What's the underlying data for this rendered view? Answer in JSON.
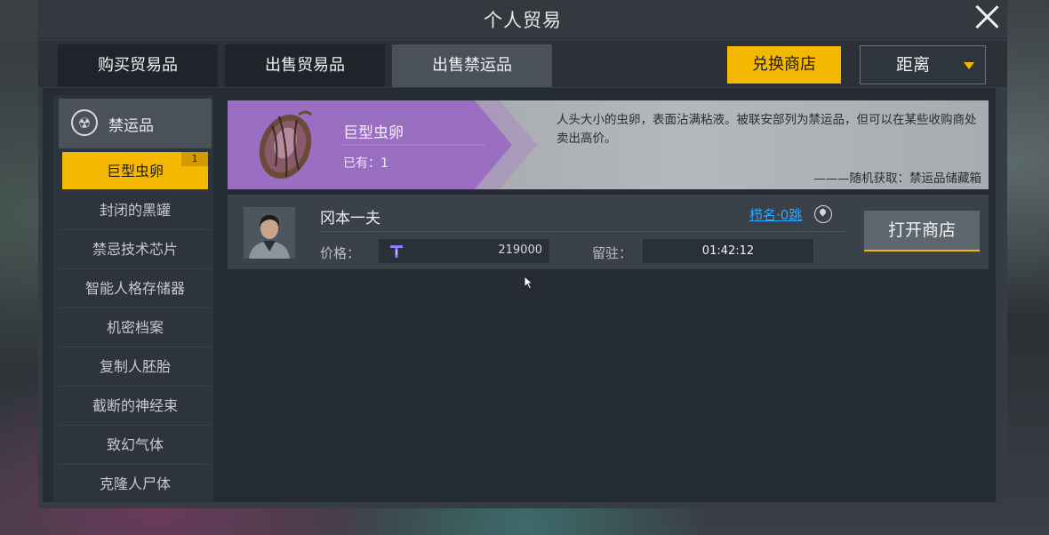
{
  "window": {
    "title": "个人贸易"
  },
  "tabs": [
    {
      "label": "购买贸易品"
    },
    {
      "label": "出售贸易品"
    },
    {
      "label": "出售禁运品",
      "active": true
    }
  ],
  "toolbar": {
    "exchange_label": "兑换商店",
    "distance_label": "距离"
  },
  "sidebar": {
    "category": {
      "label": "禁运品",
      "icon": "radiation-icon"
    },
    "items": [
      {
        "label": "巨型虫卵",
        "selected": true,
        "badge": "1"
      },
      {
        "label": "封闭的黑罐"
      },
      {
        "label": "禁忌技术芯片"
      },
      {
        "label": "智能人格存储器"
      },
      {
        "label": "机密档案"
      },
      {
        "label": "复制人胚胎"
      },
      {
        "label": "截断的神经束"
      },
      {
        "label": "致幻气体"
      },
      {
        "label": "克隆人尸体"
      }
    ]
  },
  "item": {
    "name": "巨型虫卵",
    "owned": "已有：1",
    "description": "人头大小的虫卵，表面沾满粘液。被联安部列为禁运品，但可以在某些收购商处卖出高价。",
    "source": "———随机获取：禁运品储藏箱"
  },
  "seller": {
    "name": "冈本一夫",
    "jump": "栉名·0跳",
    "price_label": "价格：",
    "price": "219000",
    "stay_label": "留驻：",
    "stay_time": "01:42:12",
    "open_shop_label": "打开商店"
  },
  "colors": {
    "accent": "#f5b800",
    "link": "#2fa8ff",
    "banner_purple": "#9a6fc2"
  }
}
